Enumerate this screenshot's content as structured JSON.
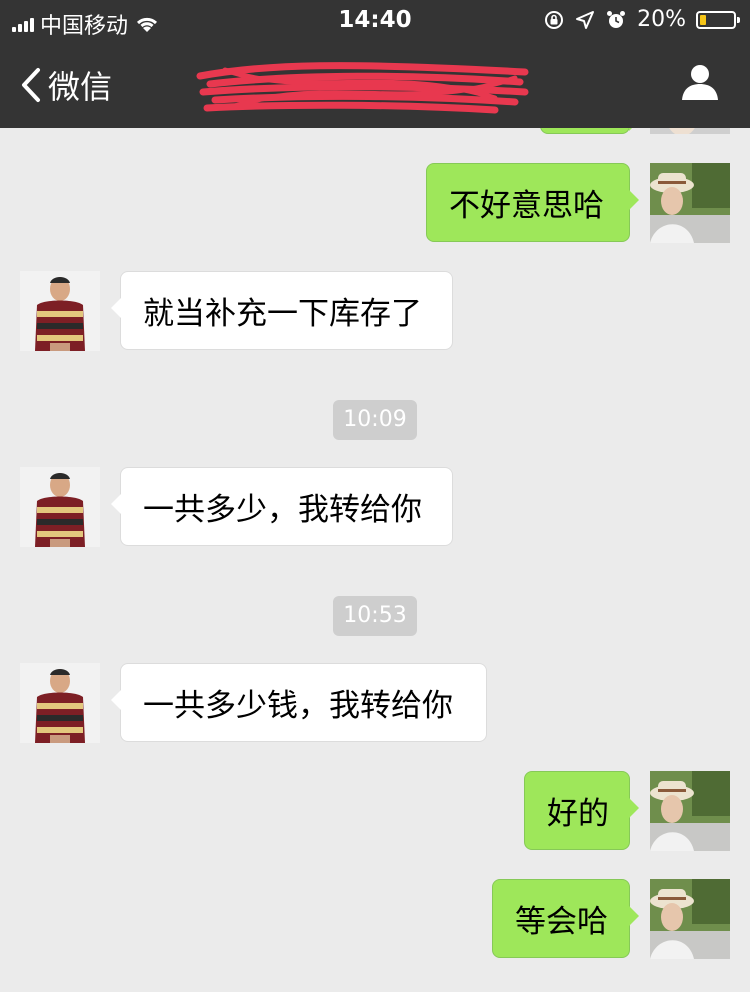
{
  "status_bar": {
    "carrier": "中国移动",
    "time": "14:40",
    "battery_percent": "20%",
    "battery_level": 0.2,
    "icons": [
      "signal-icon",
      "wifi-icon",
      "orientation-lock-icon",
      "location-arrow-icon",
      "alarm-icon",
      "battery-icon"
    ]
  },
  "nav": {
    "back_label": "微信",
    "title": "",
    "title_redacted": true,
    "icons": [
      "chevron-left-icon",
      "profile-icon"
    ]
  },
  "messages": [
    {
      "kind": "text",
      "side": "right",
      "text": "不好意思哈"
    },
    {
      "kind": "text",
      "side": "left",
      "text": "就当补充一下库存了"
    },
    {
      "kind": "time",
      "text": "10:09"
    },
    {
      "kind": "text",
      "side": "left",
      "text": "一共多少，我转给你"
    },
    {
      "kind": "time",
      "text": "10:53"
    },
    {
      "kind": "text",
      "side": "left",
      "text": "一共多少钱，我转给你"
    },
    {
      "kind": "text",
      "side": "right",
      "text": "好的"
    },
    {
      "kind": "text",
      "side": "right",
      "text": "等会哈"
    }
  ],
  "colors": {
    "header_bg": "#343434",
    "chat_bg": "#ebebeb",
    "outgoing_bubble": "#9ee75a",
    "incoming_bubble": "#ffffff",
    "timestamp_bg": "#cecece",
    "battery_fill": "#f5c518",
    "redaction_scribble": "#e8384f"
  }
}
